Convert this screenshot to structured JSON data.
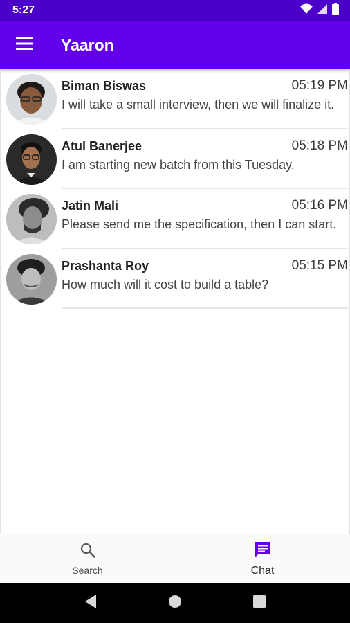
{
  "status_bar": {
    "time": "5:27"
  },
  "app_bar": {
    "title": "Yaaron"
  },
  "chats": [
    {
      "name": "Biman Biswas",
      "time": "05:19 PM",
      "message": "I will take a small interview, then we will finalize it."
    },
    {
      "name": "Atul Banerjee",
      "time": "05:18 PM",
      "message": "I am starting new batch from this Tuesday."
    },
    {
      "name": "Jatin Mali",
      "time": "05:16 PM",
      "message": "Please send me the specification, then I can start."
    },
    {
      "name": "Prashanta Roy",
      "time": "05:15 PM",
      "message": "How much will it cost to build a table?"
    }
  ],
  "bottom_nav": {
    "items": [
      {
        "label": "Search",
        "icon": "search-icon"
      },
      {
        "label": "Chat",
        "icon": "chat-icon"
      }
    ],
    "active": "Chat"
  },
  "colors": {
    "primary": "#6200ea",
    "status_bar": "#4b01c9",
    "accent": "#6200ea"
  }
}
